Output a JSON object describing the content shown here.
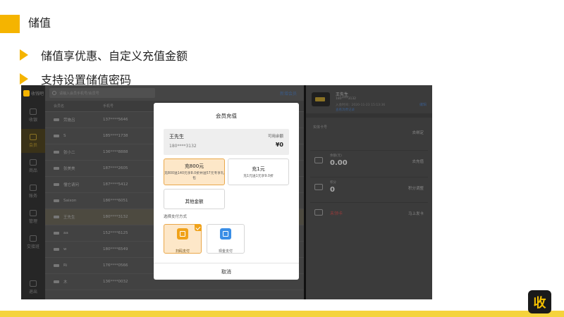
{
  "slide": {
    "title": "储值",
    "bullets": [
      "储值享优惠、自定义充值金额",
      "支持设置储值密码"
    ],
    "brand_char": "收",
    "accent_color": "#f5b400"
  },
  "app": {
    "logo_text": "收钱吧",
    "search_placeholder": "请输入会员手机号/会员号",
    "new_member": "新增会员",
    "sidebar": [
      {
        "label": "收银",
        "icon": "cashier-icon"
      },
      {
        "label": "会员",
        "icon": "member-icon"
      },
      {
        "label": "商品",
        "icon": "goods-icon"
      },
      {
        "label": "账务",
        "icon": "finance-icon"
      },
      {
        "label": "管理",
        "icon": "manage-icon"
      },
      {
        "label": "交接班",
        "icon": "shift-icon"
      },
      {
        "label": "退出",
        "icon": "exit-icon"
      }
    ],
    "list_header": [
      "会员名",
      "手机号"
    ],
    "members": [
      {
        "name": "劳施吕",
        "phone": "137****5646"
      },
      {
        "name": "S",
        "phone": "185****1738"
      },
      {
        "name": "张小二",
        "phone": "136****8888"
      },
      {
        "name": "张美美",
        "phone": "187****2605"
      },
      {
        "name": "懂它请问",
        "phone": "187****5412"
      },
      {
        "name": "Saixon",
        "phone": "186****6051"
      },
      {
        "name": "王先生",
        "phone": "180****3132",
        "selected": true
      },
      {
        "name": "aa",
        "phone": "152****6125"
      },
      {
        "name": "w",
        "phone": "180****6549"
      },
      {
        "name": "Ri",
        "phone": "176****0566"
      },
      {
        "name": "木",
        "phone": "136****0032"
      }
    ],
    "detail": {
      "name": "王先生",
      "phone": "180****3132",
      "meta": "入会时间：2020-11-23 15:13:36",
      "meta2": "查看消费记录",
      "edit": "编辑",
      "card_row": {
        "label": "实体卡号",
        "action": "去绑定"
      },
      "balance_row": {
        "label": "余额(元)",
        "value": "0.00",
        "action": "去充值"
      },
      "points_row": {
        "label": "积分",
        "value": "0",
        "action": "积分调整"
      },
      "card_promo": {
        "label": "未领卡",
        "action": "马上发卡"
      }
    }
  },
  "modal": {
    "title": "会员充值",
    "member_name": "王先生",
    "member_phone": "180****3132",
    "balance_label": "可用余额",
    "balance_value": "¥0",
    "options": [
      {
        "title": "充800元",
        "sub": "充800送140元享8.0折并送57元专享礼包",
        "selected": true
      },
      {
        "title": "充1元",
        "sub": "充1元送1元享9.0折",
        "selected": false
      },
      {
        "title": "其他金额",
        "sub": "",
        "selected": false
      }
    ],
    "pay_label": "选择支付方式",
    "pay_methods": [
      {
        "label": "扫码支付",
        "icon": "scan-pay-icon",
        "selected": true
      },
      {
        "label": "现金支付",
        "icon": "cash-pay-icon",
        "selected": false
      }
    ],
    "cancel": "取消"
  }
}
